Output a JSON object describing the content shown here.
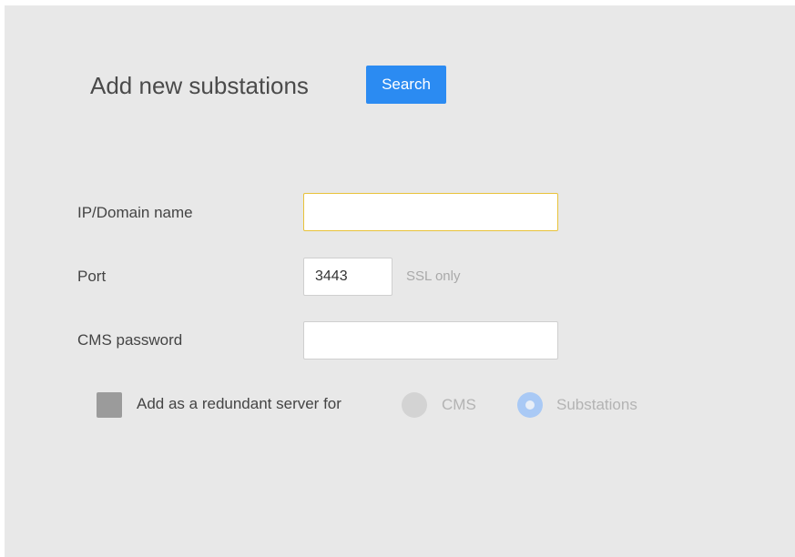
{
  "header": {
    "title": "Add new substations",
    "search_label": "Search"
  },
  "form": {
    "ip_label": "IP/Domain name",
    "ip_value": "",
    "port_label": "Port",
    "port_value": "3443",
    "port_hint": "SSL only",
    "password_label": "CMS password",
    "password_value": "",
    "redundant_label": "Add as a redundant server for",
    "redundant_checked": false,
    "radio_options": [
      "CMS",
      "Substations"
    ],
    "radio_selected": "Substations"
  },
  "colors": {
    "accent": "#2b8bf2",
    "panel_bg": "#e8e8e8",
    "focus_border": "#e8c23a"
  }
}
